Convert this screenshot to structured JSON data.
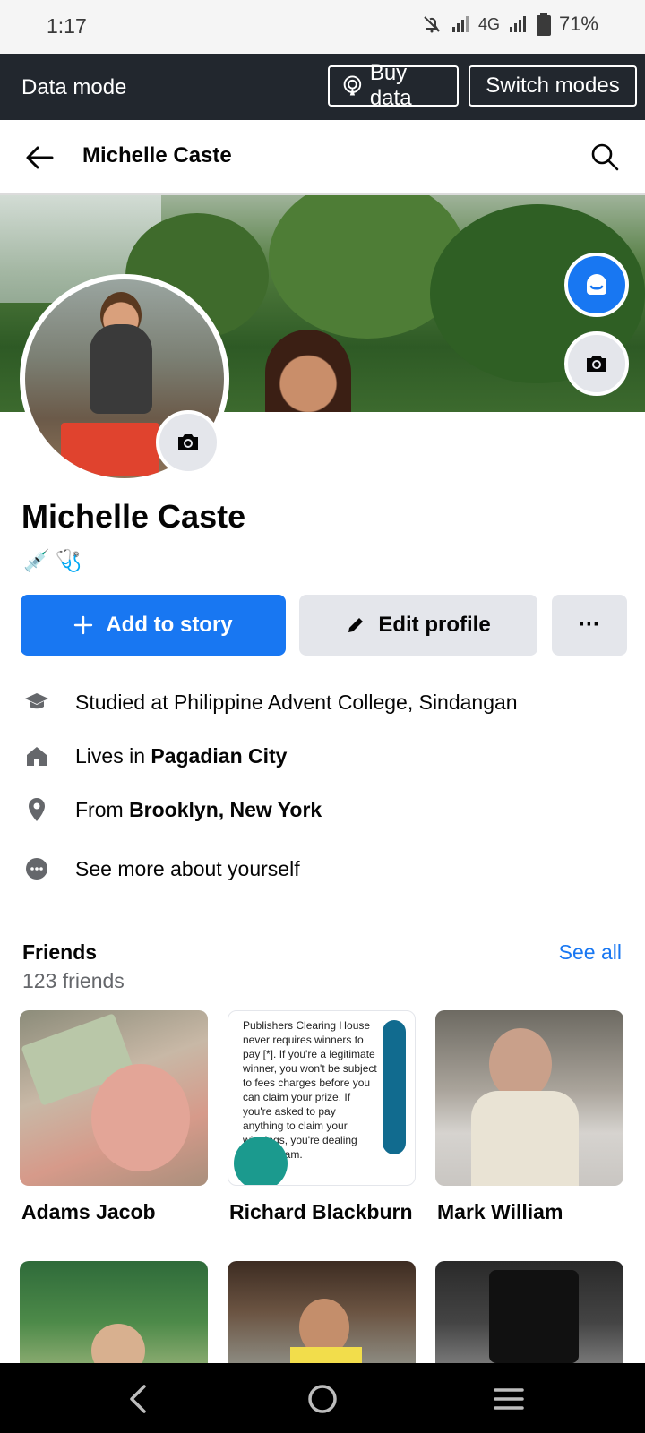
{
  "status_bar": {
    "time": "1:17",
    "network": "4G",
    "battery": "71%"
  },
  "data_bar": {
    "label": "Data mode",
    "buy_label": "Buy data",
    "switch_label": "Switch modes"
  },
  "header": {
    "title": "Michelle Caste"
  },
  "profile": {
    "name": "Michelle Caste",
    "emojis": [
      "💉",
      "🩺"
    ],
    "add_story_label": "Add to story",
    "edit_profile_label": "Edit profile",
    "more_label": "···"
  },
  "details": {
    "studied": "Studied at Philippine Advent College, Sindangan",
    "lives_prefix": "Lives in ",
    "lives_place": "Pagadian City",
    "from_prefix": "From ",
    "from_place": "Brooklyn, New York",
    "see_more": "See more about yourself"
  },
  "friends": {
    "title": "Friends",
    "count": "123 friends",
    "see_all": "See all",
    "items": [
      {
        "name": "Adams Jacob"
      },
      {
        "name": "Richard Blackburn"
      },
      {
        "name": "Mark William"
      }
    ],
    "tile2_text": "Publishers Clearing House never requires winners to pay [*]. If you're a legitimate winner, you won't be subject to fees charges before you can claim your prize. If you're asked to pay anything to claim your winnings, you're dealing with a scam."
  },
  "colors": {
    "accent": "#1877f2",
    "databar": "#22272e",
    "button_grey": "#e4e6eb"
  }
}
